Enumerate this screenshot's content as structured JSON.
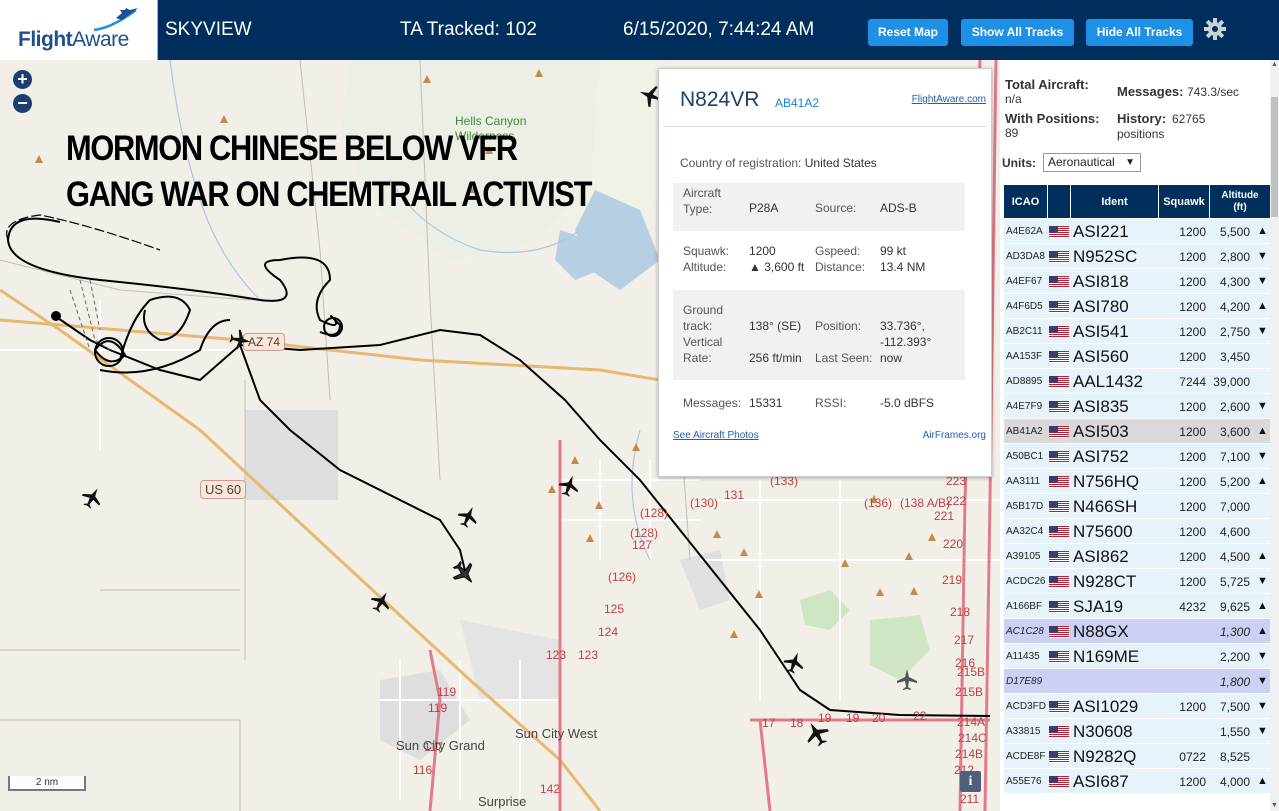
{
  "header": {
    "logo_flight": "Flight",
    "logo_aware": "Aware",
    "title": "SKYVIEW",
    "tracked": "TA Tracked: 102",
    "datetime": "6/15/2020, 7:44:24 AM",
    "buttons": {
      "reset": "Reset Map",
      "show": "Show All Tracks",
      "hide": "Hide All Tracks"
    }
  },
  "map": {
    "overlay_line1": "MORMON CHINESE BELOW VFR",
    "overlay_line2": "GANG WAR ON CHEMTRAIL ACTIVIST",
    "zoom_in": "+",
    "zoom_out": "−",
    "scale": "2 nm",
    "info": "i",
    "labels": {
      "hells_canyon": "Hells Canyon",
      "wilderness": "Wilderness",
      "az74": "AZ 74",
      "us60": "US 60",
      "sun_city_grand": "Sun City Grand",
      "sun_city_west": "Sun City West",
      "surprise": "Surprise",
      "r133": "(133)",
      "r130": "(130)",
      "r131": "131",
      "r128a": "(128)",
      "r128b": "(128)",
      "r127": "127",
      "r126": "(126)",
      "r125": "125",
      "r124": "124",
      "r123a": "123",
      "r123b": "123",
      "r119a": "119",
      "r119b": "119",
      "r117": "117",
      "r116": "116",
      "r142": "142",
      "r136": "(136)",
      "r138": "(138 A/B)",
      "r223": "223",
      "r222": "222",
      "r221": "221",
      "r220": "220",
      "r219": "219",
      "r218": "218",
      "r217": "217",
      "r216": "216",
      "r215b": "215B",
      "r215a": "215B",
      "r214a": "214A",
      "r214c": "214C",
      "r214b": "214B",
      "r212": "212",
      "r211": "211",
      "n17": "17",
      "n18": "18",
      "n19a": "19",
      "n19b": "19",
      "n20": "20",
      "n22": "22"
    }
  },
  "popup": {
    "registration": "N824VR",
    "hex": "AB41A2",
    "fa_link": "FlightAware.com",
    "country_label": "Country of registration:",
    "country": "United States",
    "aircraft_type_label": "Aircraft\nType:",
    "aircraft_type": "P28A",
    "source_label": "Source:",
    "source": "ADS-B",
    "squawk_label": "Squawk:",
    "squawk": "1200",
    "gspeed_label": "Gspeed:",
    "gspeed": "99 kt",
    "altitude_label": "Altitude:",
    "altitude": "▲ 3,600 ft",
    "distance_label": "Distance:",
    "distance": "13.4 NM",
    "track_label": "Ground\ntrack:\nVertical\nRate:",
    "track": "138° (SE)",
    "vrate": "256 ft/min",
    "position_label": "Position:",
    "position": "33.736°, -112.393°",
    "lastseen_label": "Last Seen:",
    "lastseen": "now",
    "messages_label": "Messages:",
    "messages": "15331",
    "rssi_label": "RSSI:",
    "rssi": "-5.0 dBFS",
    "photos_link": "See Aircraft Photos",
    "airframes_link": "AirFrames.org"
  },
  "sidebar": {
    "total_label": "Total Aircraft:",
    "total": "n/a",
    "positions_label": "With Positions:",
    "positions": "89",
    "messages_label": "Messages:",
    "messages": "743.3/sec",
    "history_label": "History:",
    "history": "62765",
    "history_unit": "positions",
    "units_label": "Units:",
    "units_value": "Aeronautical",
    "columns": [
      "ICAO",
      "",
      "Ident",
      "Squawk",
      "Altitude (ft)"
    ],
    "rows": [
      {
        "icao": "A4E62A",
        "flag": true,
        "ident": "ASI221",
        "squawk": "1200",
        "alt": "5,500",
        "trend": "▲"
      },
      {
        "icao": "AD3DA8",
        "flag": true,
        "ident": "N952SC",
        "squawk": "1200",
        "alt": "2,800",
        "trend": "▼"
      },
      {
        "icao": "A4EF67",
        "flag": true,
        "ident": "ASI818",
        "squawk": "1200",
        "alt": "4,300",
        "trend": "▼"
      },
      {
        "icao": "A4F6D5",
        "flag": true,
        "ident": "ASI780",
        "squawk": "1200",
        "alt": "4,200",
        "trend": "▲"
      },
      {
        "icao": "AB2C11",
        "flag": true,
        "ident": "ASI541",
        "squawk": "1200",
        "alt": "2,750",
        "trend": "▼"
      },
      {
        "icao": "AA153F",
        "flag": true,
        "ident": "ASI560",
        "squawk": "1200",
        "alt": "3,450",
        "trend": ""
      },
      {
        "icao": "AD8895",
        "flag": true,
        "ident": "AAL1432",
        "squawk": "7244",
        "alt": "39,000",
        "trend": ""
      },
      {
        "icao": "A4E7F9",
        "flag": true,
        "ident": "ASI835",
        "squawk": "1200",
        "alt": "2,600",
        "trend": "▼"
      },
      {
        "icao": "AB41A2",
        "flag": true,
        "ident": "ASI503",
        "squawk": "1200",
        "alt": "3,600",
        "trend": "▲",
        "cls": "sel"
      },
      {
        "icao": "A50BC1",
        "flag": true,
        "ident": "ASI752",
        "squawk": "1200",
        "alt": "7,100",
        "trend": "▼"
      },
      {
        "icao": "AA3111",
        "flag": true,
        "ident": "N756HQ",
        "squawk": "1200",
        "alt": "5,200",
        "trend": "▲"
      },
      {
        "icao": "A5B17D",
        "flag": true,
        "ident": "N466SH",
        "squawk": "1200",
        "alt": "7,000",
        "trend": ""
      },
      {
        "icao": "AA32C4",
        "flag": true,
        "ident": "N75600",
        "squawk": "1200",
        "alt": "4,600",
        "trend": ""
      },
      {
        "icao": "A39105",
        "flag": true,
        "ident": "ASI862",
        "squawk": "1200",
        "alt": "4,500",
        "trend": "▲"
      },
      {
        "icao": "ACDC26",
        "flag": true,
        "ident": "N928CT",
        "squawk": "1200",
        "alt": "5,725",
        "trend": "▼"
      },
      {
        "icao": "A166BF",
        "flag": true,
        "ident": "SJA19",
        "squawk": "4232",
        "alt": "9,625",
        "trend": "▲"
      },
      {
        "icao": "AC1C28",
        "flag": true,
        "ident": "N88GX",
        "squawk": "",
        "alt": "1,300",
        "trend": "▲",
        "cls": "mlat"
      },
      {
        "icao": "A11435",
        "flag": true,
        "ident": "N169ME",
        "squawk": "",
        "alt": "2,200",
        "trend": "▼"
      },
      {
        "icao": "D17E89",
        "flag": false,
        "ident": "",
        "squawk": "",
        "alt": "1,800",
        "trend": "▼",
        "cls": "mlat"
      },
      {
        "icao": "ACD3FD",
        "flag": true,
        "ident": "ASI1029",
        "squawk": "1200",
        "alt": "7,500",
        "trend": "▼"
      },
      {
        "icao": "A33815",
        "flag": true,
        "ident": "N30608",
        "squawk": "",
        "alt": "1,550",
        "trend": "▼"
      },
      {
        "icao": "ACDE8F",
        "flag": true,
        "ident": "N9282Q",
        "squawk": "0722",
        "alt": "8,525",
        "trend": ""
      },
      {
        "icao": "A55E76",
        "flag": true,
        "ident": "ASI687",
        "squawk": "1200",
        "alt": "4,000",
        "trend": "▲"
      }
    ]
  },
  "colors": {
    "header_bg": "#002f5d",
    "button": "#1e90e6",
    "map_bg": "#f2efe9",
    "track": "#000000",
    "table_row": "#e6f3fb",
    "row_selected": "#d9d9d9",
    "row_mlat": "#ccd0f4"
  }
}
